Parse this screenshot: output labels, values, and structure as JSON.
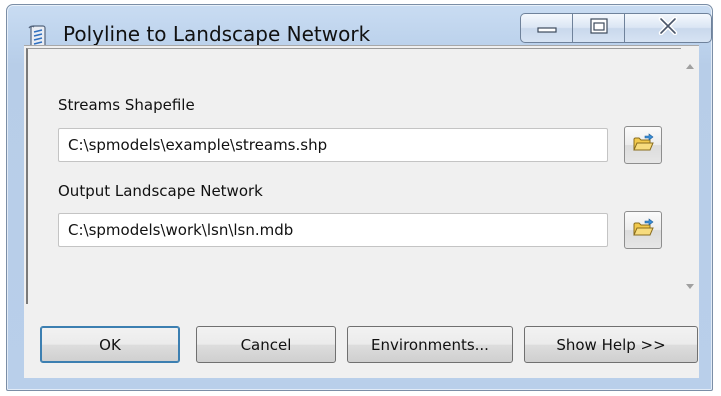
{
  "window": {
    "title": "Polyline to Landscape Network",
    "icon": "toolbox-script-icon"
  },
  "caption": {
    "icons": [
      "minimize-icon",
      "maximize-icon",
      "close-icon"
    ]
  },
  "fields": [
    {
      "label": "Streams Shapefile",
      "value": "C:\\spmodels\\example\\streams.shp"
    },
    {
      "label": "Output Landscape Network",
      "value": "C:\\spmodels\\work\\lsn\\lsn.mdb"
    }
  ],
  "buttons": {
    "ok": "OK",
    "cancel": "Cancel",
    "environments": "Environments...",
    "help": "Show Help >>"
  },
  "colors": {
    "frame": "#b9cfea",
    "folder": "#f2c94c"
  }
}
